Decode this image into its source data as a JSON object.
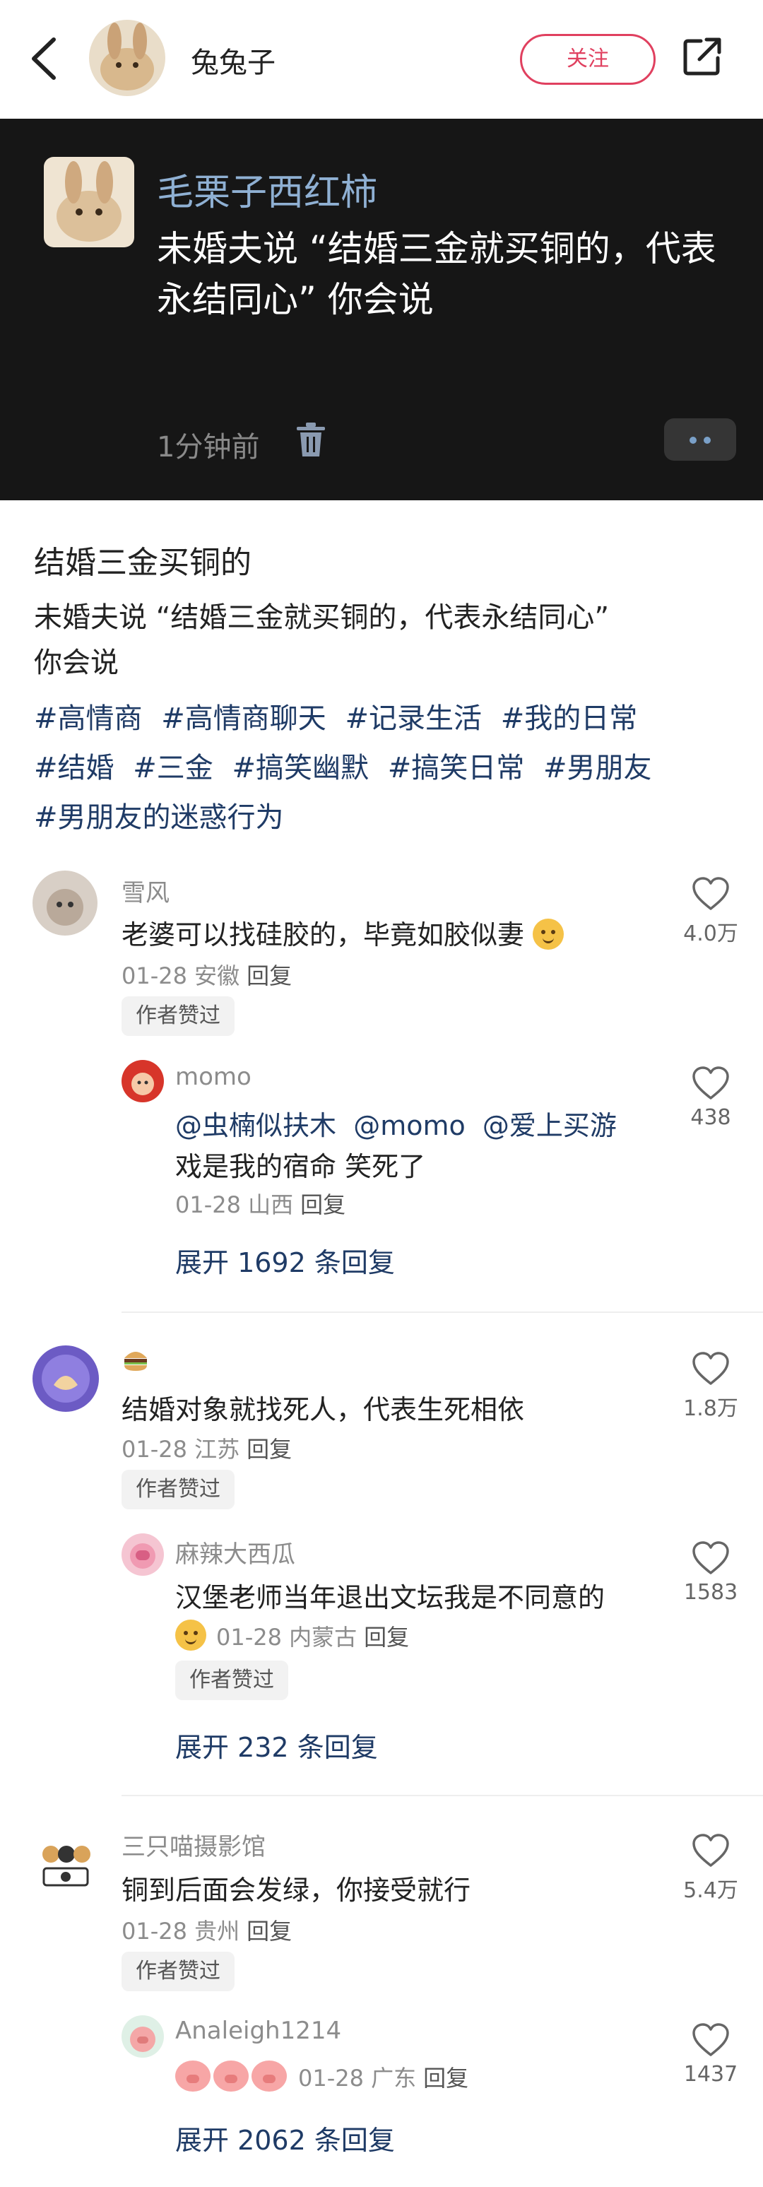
{
  "header": {
    "username": "兔兔子",
    "follow_label": "关注"
  },
  "quoted": {
    "author": "毛栗子西红柿",
    "text": "未婚夫说 “结婚三金就买铜的，代表永结同心” 你会说",
    "time": "1分钟前"
  },
  "post": {
    "title": "结婚三金买铜的",
    "desc_line1": "未婚夫说 “结婚三金就买铜的，代表永结同心”",
    "desc_line2": "你会说",
    "tags": [
      "#高情商",
      "#高情商聊天",
      "#记录生活",
      "#我的日常",
      "#结婚",
      "#三金",
      "#搞笑幽默",
      "#搞笑日常",
      "#男朋友",
      "#男朋友的迷惑行为"
    ]
  },
  "comments": [
    {
      "author": "雪风",
      "text": "老婆可以找硅胶的，毕竟如胶似妻",
      "meta": "01-28 安徽",
      "reply_label": "回复",
      "badge": "作者赞过",
      "likes": "4.0万",
      "sub": {
        "author": "momo",
        "mention1": "@虫楠似扶木",
        "mention2": "@momo",
        "mention3": "@爱上买游",
        "text_rest_line1": "",
        "text_line2": "戏是我的宿命 笑死了",
        "meta": "01-28 山西",
        "reply_label": "回复",
        "likes": "438"
      },
      "expand": "展开 1692 条回复"
    },
    {
      "author": "",
      "text": "结婚对象就找死人，代表生死相依",
      "meta": "01-28 江苏",
      "reply_label": "回复",
      "badge": "作者赞过",
      "likes": "1.8万",
      "sub": {
        "author": "麻辣大西瓜",
        "text": "汉堡老师当年退出文坛我是不同意的",
        "meta": "01-28 内蒙古",
        "reply_label": "回复",
        "badge": "作者赞过",
        "likes": "1583"
      },
      "expand": "展开 232 条回复"
    },
    {
      "author": "三只喵摄影馆",
      "text": "铜到后面会发绿，你接受就行",
      "meta": "01-28 贵州",
      "reply_label": "回复",
      "badge": "作者赞过",
      "likes": "5.4万",
      "sub": {
        "author": "Analeigh1214",
        "meta": "01-28 广东",
        "reply_label": "回复",
        "likes": "1437"
      },
      "expand": "展开 2062 条回复"
    }
  ]
}
